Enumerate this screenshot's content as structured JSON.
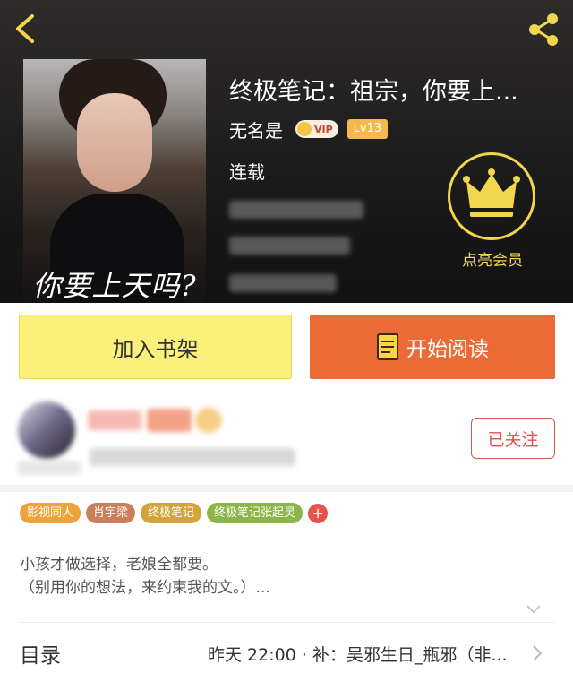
{
  "header": {
    "back_icon": "chevron-left-icon",
    "share_icon": "share-icon",
    "accent_color": "#f2d64c"
  },
  "book": {
    "cover_title": "你要上天吗?",
    "title": "终极笔记：祖宗，你要上...",
    "author": "无名是",
    "vip_label": "VIP",
    "level": "Lv13",
    "status": "连载"
  },
  "member": {
    "icon": "crown-icon",
    "label": "点亮会员"
  },
  "actions": {
    "add_shelf": "加入书架",
    "start_reading": "开始阅读",
    "add_color": "#fbf07a",
    "read_color": "#ec6a36"
  },
  "uploader": {
    "follow_label": "已关注"
  },
  "tags": [
    {
      "label": "影视同人",
      "color": "#f0a23a"
    },
    {
      "label": "肖宇梁",
      "color": "#c9805a"
    },
    {
      "label": "终极笔记",
      "color": "#d4a43a"
    },
    {
      "label": "终极笔记张起灵",
      "color": "#8bb546"
    }
  ],
  "tag_add": "+",
  "description": {
    "line1": "小孩才做选择，老娘全都要。",
    "line2": "（别用你的想法，来约束我的文。）..."
  },
  "toc": {
    "label": "目录",
    "latest": "昨天 22:00 · 补：吴邪生日_瓶邪（非..."
  }
}
